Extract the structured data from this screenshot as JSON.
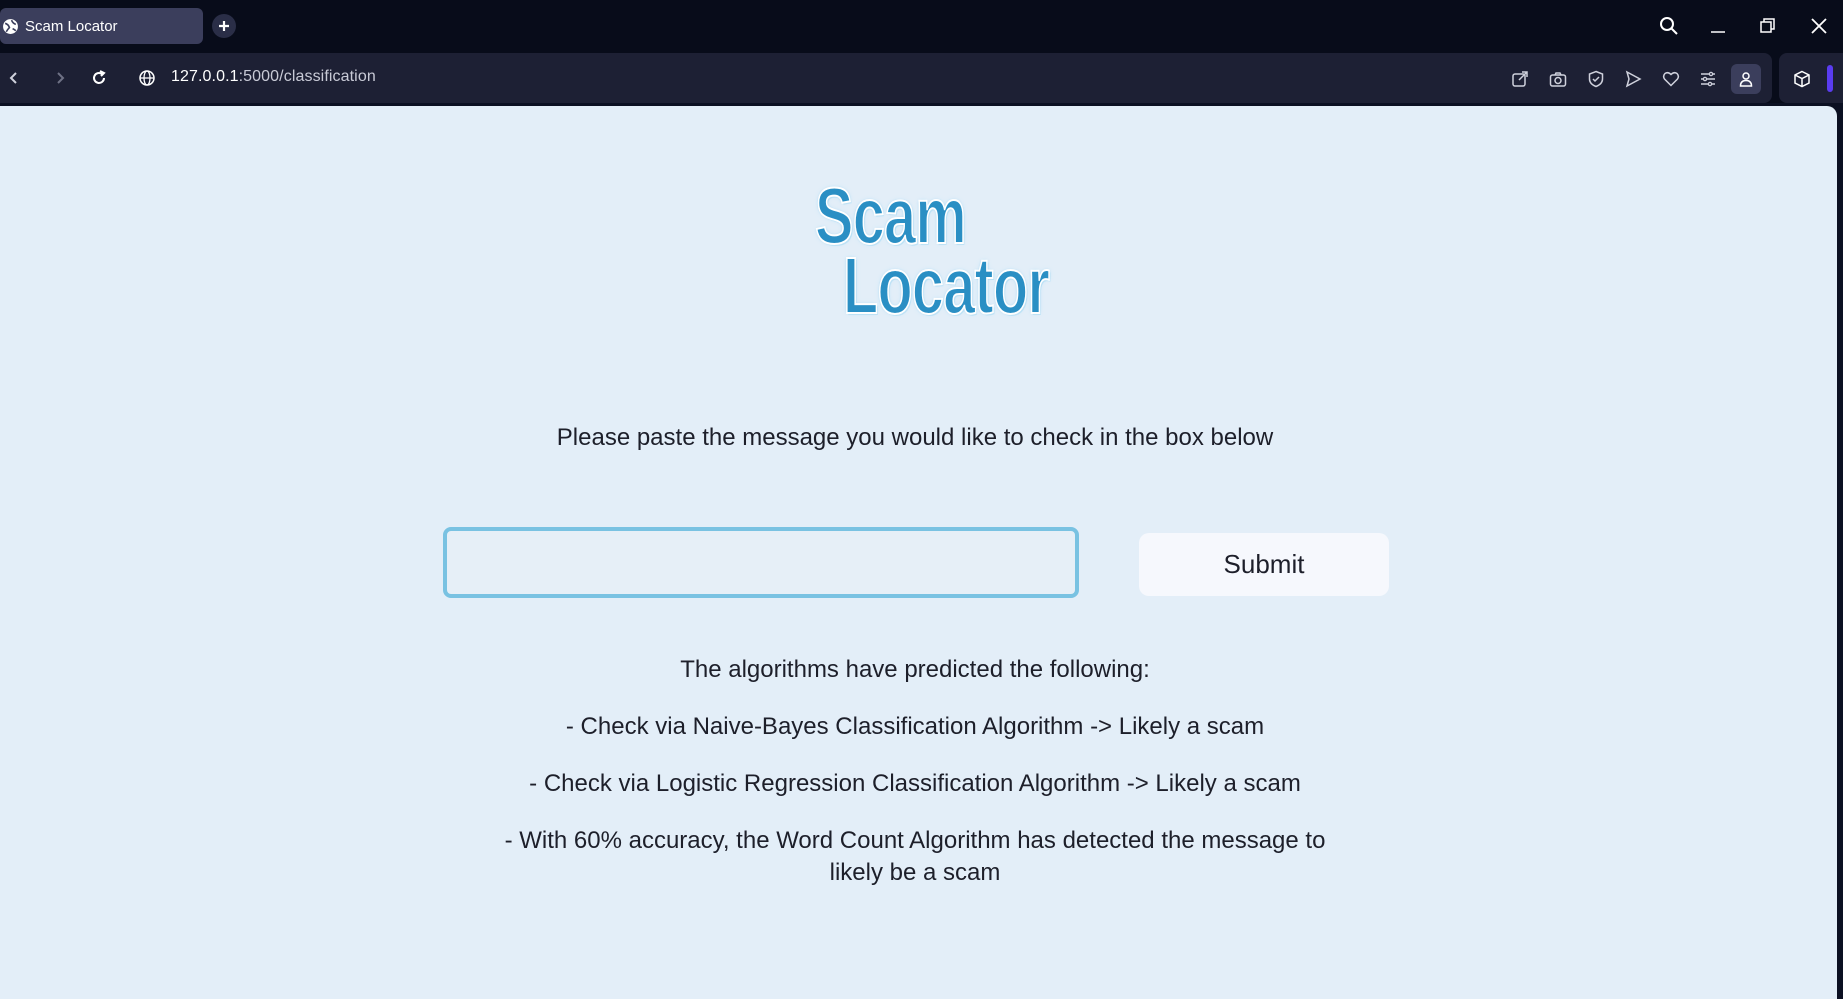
{
  "browser": {
    "tab": {
      "title": "Scam Locator",
      "favicon": "globe-icon"
    },
    "address": {
      "host": "127.0.0.1",
      "path": ":5000/classification"
    },
    "toolbar_icons": [
      "share-icon",
      "camera-icon",
      "shield-icon",
      "send-icon",
      "heart-icon",
      "menu-icon",
      "profile-icon",
      "cube-icon"
    ],
    "accent_color": "#5a3cf0"
  },
  "page": {
    "logo": {
      "line1": "Scam",
      "line2": "Locator",
      "color": "#2a8fc4"
    },
    "instruction": "Please paste the message you would like to check in the box below",
    "message_input": {
      "value": "",
      "placeholder": ""
    },
    "submit_label": "Submit",
    "results": {
      "heading": "The algorithms have predicted the following:",
      "lines": [
        "- Check via Naive-Bayes Classification Algorithm -> Likely a scam",
        "- Check via Logistic Regression Classification Algorithm -> Likely a scam",
        "- With 60% accuracy, the Word Count Algorithm has detected the message to likely be a scam"
      ]
    },
    "background_color": "#e3eef8",
    "input_border_color": "#79c2e2"
  }
}
